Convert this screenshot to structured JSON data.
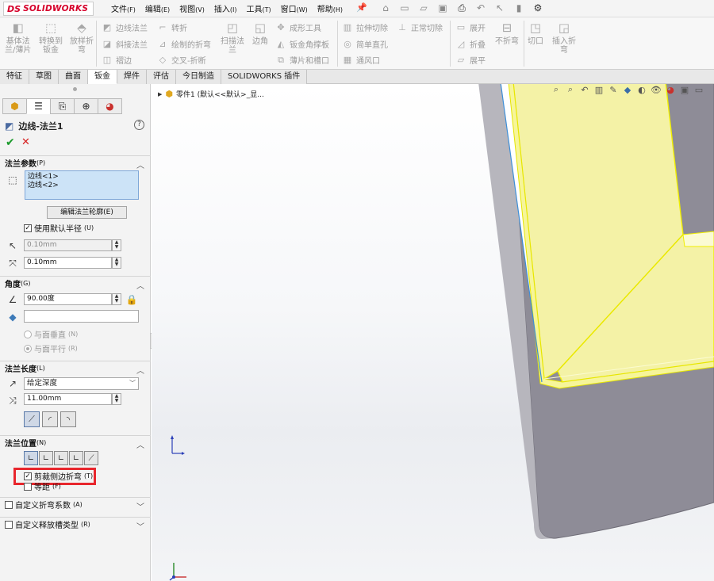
{
  "app": {
    "logo_prefix": "DS",
    "logo_name": "SOLIDWORKS"
  },
  "menu": [
    {
      "label": "文件",
      "key": "(F)"
    },
    {
      "label": "编辑",
      "key": "(E)"
    },
    {
      "label": "视图",
      "key": "(V)"
    },
    {
      "label": "插入",
      "key": "(I)"
    },
    {
      "label": "工具",
      "key": "(T)"
    },
    {
      "label": "窗口",
      "key": "(W)"
    },
    {
      "label": "帮助",
      "key": "(H)"
    }
  ],
  "quick_icons": [
    "home-icon",
    "new-icon",
    "open-icon",
    "save-icon",
    "print-icon",
    "undo-icon",
    "select-icon",
    "rebuild-icon",
    "options-icon"
  ],
  "ribbon": {
    "base_flange": "基体法\n兰/薄片",
    "convert_to_sheet": "转换到\n钣金",
    "lofted_bend": "放样折\n弯",
    "edge_flange": "边线法兰",
    "miter_flange": "斜接法兰",
    "hem": "褶边",
    "jog": "转折",
    "sketched_bend": "绘制的折弯",
    "cross_break": "交叉-折断",
    "swept_flange": "扫描法\n兰",
    "corners": "边角",
    "forming_tool": "成形工具",
    "sheet_metal_gusset": "钣金角撑板",
    "tab_and_slot": "薄片和槽口",
    "extruded_cut": "拉伸切除",
    "simple_hole": "简单直孔",
    "vent": "通风口",
    "normal_cut": "正常切除",
    "unfold": "展开",
    "fold": "折叠",
    "flatten": "展平",
    "no_bends": "不折弯",
    "rip": "切口",
    "insert_bends": "插入折\n弯"
  },
  "tabs": [
    "特征",
    "草图",
    "曲面",
    "钣金",
    "焊件",
    "评估",
    "今日制造",
    "SOLIDWORKS 插件"
  ],
  "active_tab_index": 3,
  "panel": {
    "feature_name": "边线-法兰1",
    "params_section": {
      "label": "法兰参数",
      "key": "(P)"
    },
    "selected_edges": [
      "边线<1>",
      "边线<2>"
    ],
    "edit_profile_button": "编辑法兰轮廓(E)",
    "use_default_radius": {
      "label": "使用默认半径",
      "key": "(U)",
      "checked": true
    },
    "bend_radius": "0.10mm",
    "gap_distance": "0.10mm",
    "angle_section": {
      "label": "角度",
      "key": "(G)"
    },
    "angle_value": "90.00度",
    "angle_face_value": "",
    "perpendicular_option": {
      "label": "与面垂直",
      "key": "(N)"
    },
    "parallel_option": {
      "label": "与面平行",
      "key": "(R)"
    },
    "length_section": {
      "label": "法兰长度",
      "key": "(L)"
    },
    "end_condition": "给定深度",
    "length_value": "11.00mm",
    "position_section": {
      "label": "法兰位置",
      "key": "(N)"
    },
    "trim_side_bends": {
      "label": "剪裁侧边折弯",
      "key": "(T)",
      "checked": true
    },
    "offset": {
      "label": "等距",
      "key": "(F)",
      "checked": false
    },
    "custom_bend_allowance": {
      "label": "自定义折弯系数",
      "key": "(A)",
      "checked": false
    },
    "custom_relief_type": {
      "label": "自定义释放槽类型",
      "key": "(R)",
      "checked": false
    }
  },
  "tree": {
    "part_label": "零件1 (默认<<默认>_显..."
  },
  "colors": {
    "highlight_red": "#e8262d",
    "flange_yellow": "#f5f3a8",
    "flange_edge": "#f2f200",
    "body_gray": "#8c8a95",
    "selection_blue": "#cce3f7"
  }
}
